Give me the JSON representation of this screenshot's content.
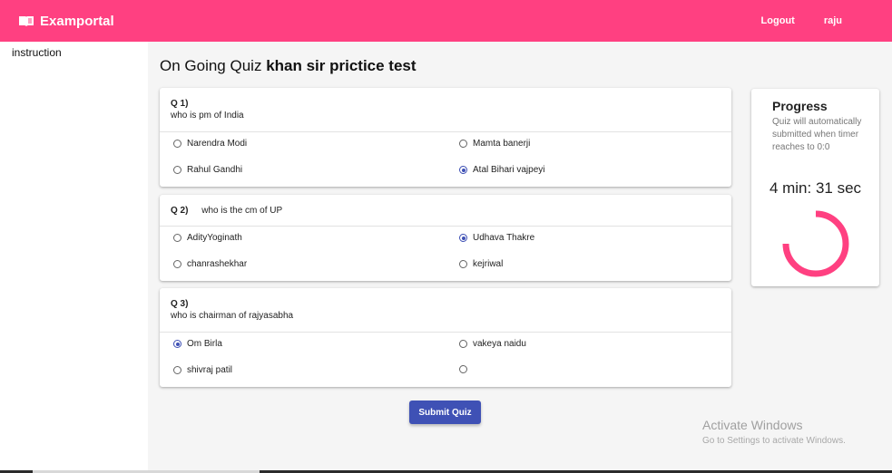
{
  "navbar": {
    "brand": "Examportal",
    "brand_icon": "book-icon",
    "logout": "Logout",
    "user": "raju",
    "color": "#ff4081"
  },
  "sidebar": {
    "items": [
      {
        "label": "instruction"
      }
    ]
  },
  "page": {
    "title_prefix": "On Going Quiz",
    "quiz_name": "khan sir prictice test"
  },
  "questions": [
    {
      "num": "Q 1)",
      "text": "who is pm of India",
      "options": [
        {
          "label": "Narendra Modi",
          "selected": false
        },
        {
          "label": "Mamta banerji",
          "selected": false
        },
        {
          "label": "Rahul Gandhi",
          "selected": false
        },
        {
          "label": "Atal Bihari vajpeyi",
          "selected": true
        }
      ]
    },
    {
      "num": "Q 2)",
      "text": "who is the cm of UP",
      "options": [
        {
          "label": "AdityYoginath",
          "selected": false
        },
        {
          "label": "Udhava Thakre",
          "selected": true
        },
        {
          "label": "chanrashekhar",
          "selected": false
        },
        {
          "label": "kejriwal",
          "selected": false
        }
      ]
    },
    {
      "num": "Q 3)",
      "text": "who is chairman of rajyasabha",
      "options": [
        {
          "label": "Om Birla",
          "selected": true
        },
        {
          "label": "vakeya naidu",
          "selected": false
        },
        {
          "label": "shivraj patil",
          "selected": false
        },
        {
          "label": "",
          "selected": false
        }
      ]
    }
  ],
  "submit_label": "Submit Quiz",
  "progress": {
    "title": "Progress",
    "note": "Quiz will automatically submitted when timer reaches to 0:0",
    "timer": "4 min: 31 sec",
    "color": "#ff4081"
  },
  "watermark": {
    "title": "Activate Windows",
    "subtitle": "Go to Settings to activate Windows."
  },
  "accent": "#3f51b5"
}
